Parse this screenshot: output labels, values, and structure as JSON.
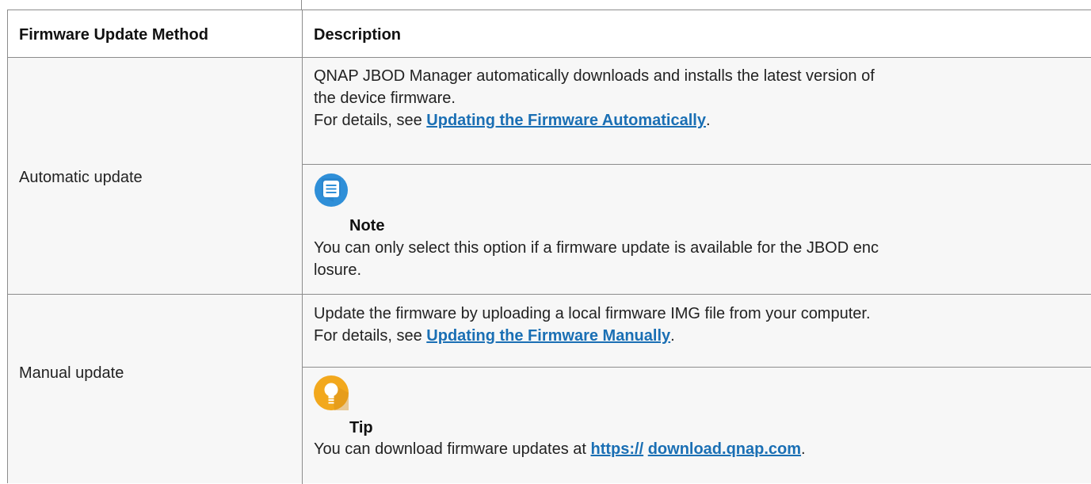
{
  "table": {
    "headers": {
      "method": "Firmware Update Method",
      "description": "Description"
    },
    "rows": [
      {
        "method": "Automatic update",
        "description_line1": "QNAP JBOD Manager automatically downloads and installs the latest version of",
        "description_line2": "the device firmware.",
        "details_prefix": "For details, see ",
        "details_link": "Updating the Firmware Automatically",
        "details_suffix": ".",
        "note_label": "Note",
        "note_line1": "You can only select this option if a firmware update is available for the JBOD enc",
        "note_line2": "losure."
      },
      {
        "method": "Manual update",
        "description_line1": "Update the firmware by uploading a local firmware IMG file from your computer.",
        "details_prefix": "For details, see ",
        "details_link": "Updating the Firmware Manually",
        "details_suffix": ".",
        "tip_label": "Tip",
        "tip_prefix": "You can download firmware updates at ",
        "tip_link1": "https://",
        "tip_space": " ",
        "tip_link2": "download.qnap.com",
        "tip_suffix": "."
      }
    ]
  },
  "colors": {
    "note_icon": "#2f8fd8",
    "tip_icon": "#f2a81d",
    "link": "#1a6fb4"
  },
  "icons": {
    "note": "note-icon",
    "tip": "lightbulb-icon"
  }
}
